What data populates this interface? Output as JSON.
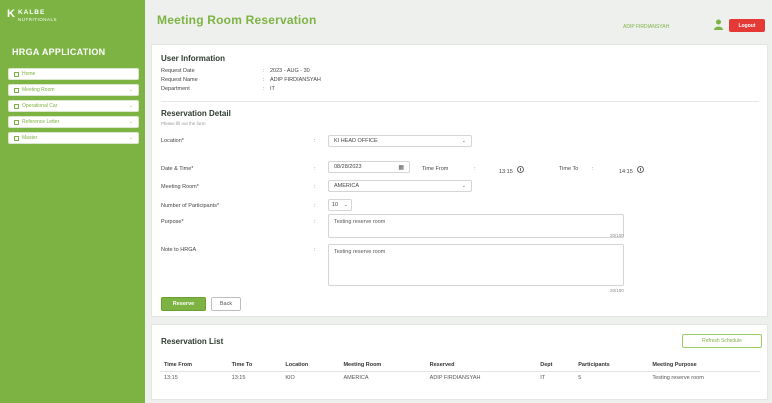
{
  "brand": {
    "mark": "K",
    "name": "KALBE",
    "sub": "NUTRITIONALS"
  },
  "app_title": "HRGA APPLICATION",
  "nav": [
    {
      "label": "Home",
      "icon": "home-icon",
      "chevron": false
    },
    {
      "label": "Meeting Room",
      "icon": "calendar-icon",
      "chevron": true
    },
    {
      "label": "Operational Car",
      "icon": "car-icon",
      "chevron": true
    },
    {
      "label": "Reference Letter",
      "icon": "document-icon",
      "chevron": true
    },
    {
      "label": "Master",
      "icon": "database-icon",
      "chevron": true
    }
  ],
  "header": {
    "title": "Meeting Room Reservation",
    "user": "ADIP FIRDIANSYAH",
    "logout": "Logout"
  },
  "user_info": {
    "title": "User Information",
    "rows": [
      {
        "label": "Request Date",
        "value": "2023 - AUG - 30"
      },
      {
        "label": "Request Name",
        "value": "ADIP FIRDIANSYAH"
      },
      {
        "label": "Department",
        "value": "IT"
      }
    ]
  },
  "reservation": {
    "title": "Reservation Detail",
    "hint": "Please fill out the form",
    "location_label": "Location*",
    "location_value": "KI HEAD OFFICE",
    "date_label": "Date & Time*",
    "date_value": "08/28/2023",
    "time_from_label": "Time From",
    "time_from_value": "13:15",
    "time_to_label": "Time To",
    "time_to_value": "14:15",
    "room_label": "Meeting Room*",
    "room_value": "AMERICA",
    "participants_label": "Number of Participants*",
    "participants_value": "10",
    "purpose_label": "Purpose*",
    "purpose_value": "Testing reserve room",
    "purpose_counter": "20/100",
    "note_label": "Note to HRGA",
    "note_value": "Testing reserve room",
    "note_counter": "20/100",
    "submit": "Reserve",
    "back": "Back"
  },
  "list": {
    "title": "Reservation List",
    "schedule_button": "Refresh Schedule",
    "columns": [
      "Time From",
      "Time To",
      "Location",
      "Meeting Room",
      "Reserved",
      "Dept",
      "Participants",
      "Meeting Purpose"
    ],
    "rows": [
      [
        "13:15",
        "13:15",
        "KIO",
        "AMERICA",
        "ADIP FIRDIANSYAH",
        "IT",
        "5",
        "Testing reserve room"
      ]
    ]
  }
}
